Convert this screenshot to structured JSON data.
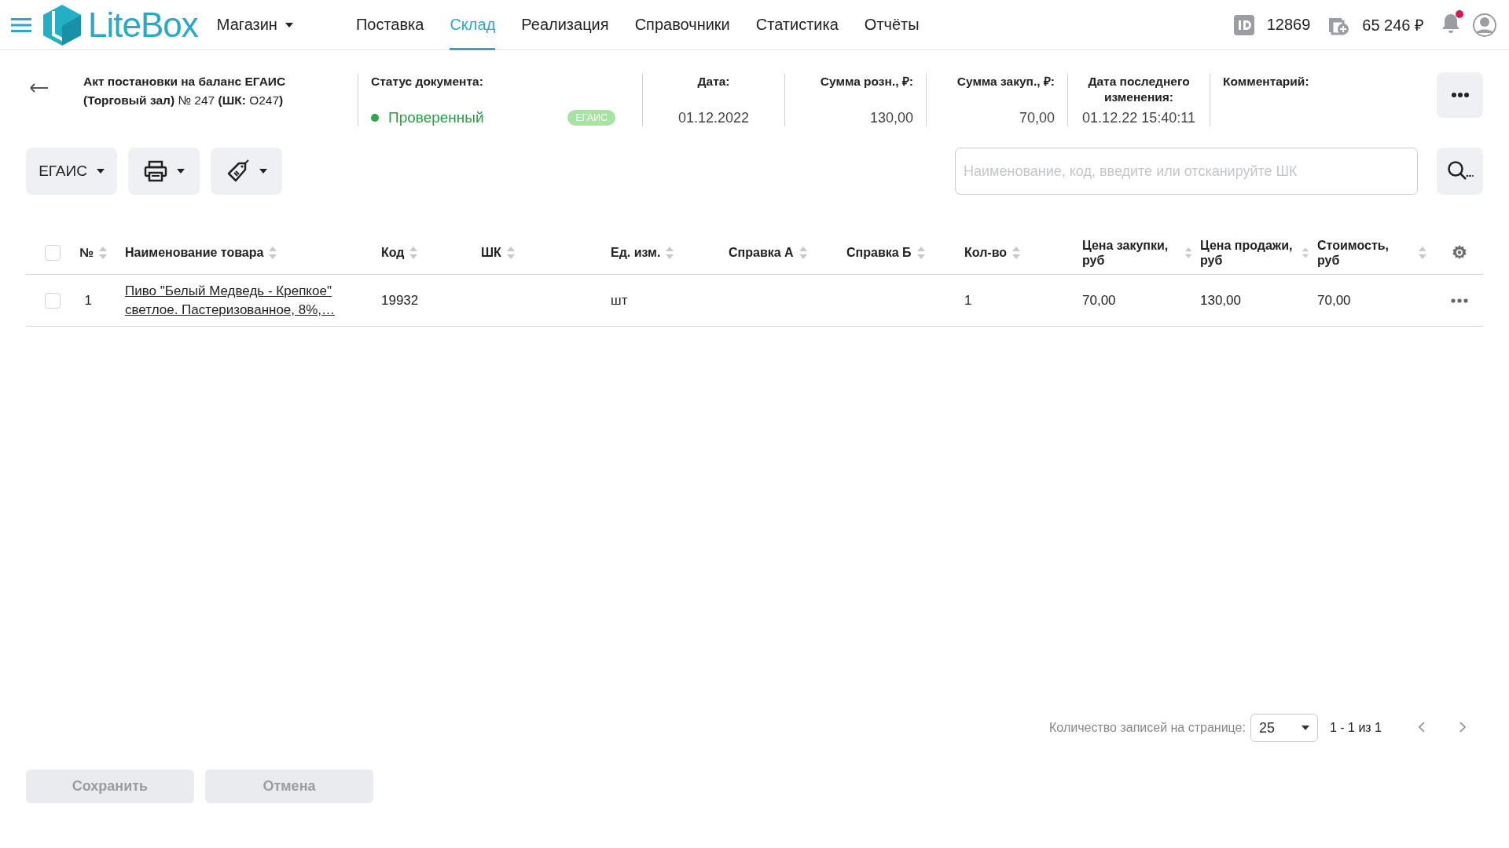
{
  "topbar": {
    "logo": "LiteBox",
    "store_menu": "Магазин",
    "nav": [
      {
        "label": "Поставка",
        "selected": false
      },
      {
        "label": "Склад",
        "selected": true
      },
      {
        "label": "Реализация",
        "selected": false
      },
      {
        "label": "Справочники",
        "selected": false
      },
      {
        "label": "Статистика",
        "selected": false
      },
      {
        "label": "Отчёты",
        "selected": false
      }
    ],
    "account_id": "12869",
    "balance": "65 246 ₽",
    "notifications": {
      "unread": true
    }
  },
  "document": {
    "title": "**Акт постановки на баланс ЕГАИС (Торговый зал)** № 247 **(ШК:** О247**)**",
    "status": {
      "label": "Статус документа:",
      "value": "Проверенный",
      "badge": "ЕГАИС"
    },
    "fields": [
      {
        "kind": "date",
        "label": "Дата:",
        "value": "01.12.2022"
      },
      {
        "kind": "amount",
        "label": "Сумма розн., ₽:",
        "value": "130,00"
      },
      {
        "kind": "amount",
        "label": "Сумма закуп., ₽:",
        "value": "70,00"
      },
      {
        "kind": "date",
        "label": "Дата последнего изменения:",
        "value": "01.12.22 15:40:11"
      },
      {
        "kind": "comment",
        "label": "Комментарий:"
      }
    ]
  },
  "toolbar": {
    "egais_menu": "ЕГАИС",
    "search": {
      "placeholder": "Наименование, код, введите или отсканируйте ШК"
    }
  },
  "table": {
    "header_checked": false,
    "columns": [
      {
        "label": "№",
        "kind": "number"
      },
      {
        "label": "Наименование товара",
        "kind": "link"
      },
      {
        "label": "Код",
        "kind": "text"
      },
      {
        "label": "ШК",
        "kind": "text"
      },
      {
        "label": "Ед. изм.",
        "kind": "text"
      },
      {
        "label": "Справка А",
        "kind": "text"
      },
      {
        "label": "Справка Б",
        "kind": "text"
      },
      {
        "label": "Кол-во",
        "kind": "text"
      },
      {
        "label": "Цена закупки, руб",
        "kind": "text"
      },
      {
        "label": "Цена продажи, руб",
        "kind": "text"
      },
      {
        "label": "Стоимость, руб",
        "kind": "text"
      }
    ],
    "rows": [
      {
        "selected": false,
        "cells": [
          "1",
          "Пиво \"Белый Медведь - Крепкое\" светлое. Пастеризованное, 8%,…",
          "19932",
          null,
          "шт",
          null,
          null,
          "1",
          "70,00",
          "130,00",
          "70,00"
        ]
      }
    ]
  },
  "pagination": {
    "label": "Количество записей на странице:",
    "page_size": "25",
    "range": "1 - 1 из 1"
  },
  "actions": [
    {
      "label": "Сохранить",
      "disabled": true
    },
    {
      "label": "Отмена",
      "disabled": true
    }
  ]
}
